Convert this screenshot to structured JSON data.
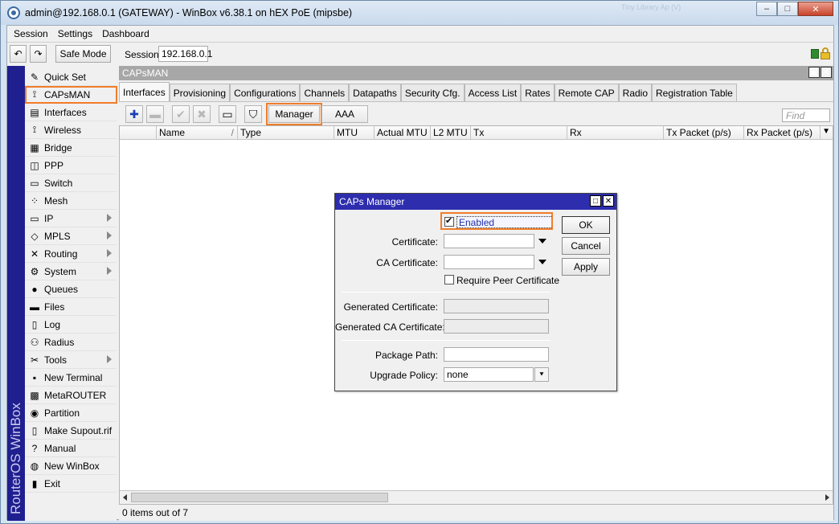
{
  "window": {
    "title": "admin@192.168.0.1 (GATEWAY) - WinBox v6.38.1 on hEX PoE (mipsbe)",
    "ghost_text": "Tiny Library Ap (V)",
    "minimize_glyph": "–",
    "maximize_glyph": "□",
    "close_glyph": "✕"
  },
  "menu": [
    "Session",
    "Settings",
    "Dashboard"
  ],
  "toolbar": {
    "undo_glyph": "↶",
    "redo_glyph": "↷",
    "safe_mode_label": "Safe Mode",
    "session_label": "Session:",
    "session_value": "192.168.0.1"
  },
  "brand": "RouterOS WinBox",
  "sidebar": {
    "items": [
      {
        "label": "Quick Set",
        "icon": "wand-icon",
        "glyph": "✎",
        "submenu": false
      },
      {
        "label": "CAPsMAN",
        "icon": "antenna-icon",
        "glyph": "⟟",
        "submenu": false
      },
      {
        "label": "Interfaces",
        "icon": "interfaces-icon",
        "glyph": "▤",
        "submenu": false
      },
      {
        "label": "Wireless",
        "icon": "wireless-icon",
        "glyph": "⟟",
        "submenu": false
      },
      {
        "label": "Bridge",
        "icon": "bridge-icon",
        "glyph": "▦",
        "submenu": false
      },
      {
        "label": "PPP",
        "icon": "ppp-icon",
        "glyph": "◫",
        "submenu": false
      },
      {
        "label": "Switch",
        "icon": "switch-icon",
        "glyph": "▭",
        "submenu": false
      },
      {
        "label": "Mesh",
        "icon": "mesh-icon",
        "glyph": "⁘",
        "submenu": false
      },
      {
        "label": "IP",
        "icon": "ip-icon",
        "glyph": "▭",
        "submenu": true
      },
      {
        "label": "MPLS",
        "icon": "mpls-icon",
        "glyph": "◇",
        "submenu": true
      },
      {
        "label": "Routing",
        "icon": "routing-icon",
        "glyph": "✕",
        "submenu": true
      },
      {
        "label": "System",
        "icon": "gear-icon",
        "glyph": "⚙",
        "submenu": true
      },
      {
        "label": "Queues",
        "icon": "queues-icon",
        "glyph": "●",
        "submenu": false
      },
      {
        "label": "Files",
        "icon": "folder-icon",
        "glyph": "▬",
        "submenu": false
      },
      {
        "label": "Log",
        "icon": "log-icon",
        "glyph": "▯",
        "submenu": false
      },
      {
        "label": "Radius",
        "icon": "radius-icon",
        "glyph": "⚇",
        "submenu": false
      },
      {
        "label": "Tools",
        "icon": "tools-icon",
        "glyph": "✂",
        "submenu": true
      },
      {
        "label": "New Terminal",
        "icon": "terminal-icon",
        "glyph": "▪",
        "submenu": false
      },
      {
        "label": "MetaROUTER",
        "icon": "metarouter-icon",
        "glyph": "▩",
        "submenu": false
      },
      {
        "label": "Partition",
        "icon": "partition-icon",
        "glyph": "◉",
        "submenu": false
      },
      {
        "label": "Make Supout.rif",
        "icon": "document-icon",
        "glyph": "▯",
        "submenu": false
      },
      {
        "label": "Manual",
        "icon": "help-icon",
        "glyph": "?",
        "submenu": false
      },
      {
        "label": "New WinBox",
        "icon": "globe-icon",
        "glyph": "◍",
        "submenu": false
      },
      {
        "label": "Exit",
        "icon": "exit-icon",
        "glyph": "▮",
        "submenu": false
      }
    ]
  },
  "panel": {
    "title": "CAPsMAN",
    "restore_glyph": "▣",
    "close_glyph": "✕",
    "tabs": [
      "Interfaces",
      "Provisioning",
      "Configurations",
      "Channels",
      "Datapaths",
      "Security Cfg.",
      "Access List",
      "Rates",
      "Remote CAP",
      "Radio",
      "Registration Table"
    ],
    "toolbar": {
      "add_glyph": "✚",
      "remove_glyph": "▬",
      "enable_glyph": "✔",
      "disable_glyph": "✖",
      "comment_glyph": "▭",
      "filter_glyph": "⛉",
      "manager_label": "Manager",
      "aaa_label": "AAA",
      "find_placeholder": "Find"
    },
    "columns": [
      "",
      "Name",
      "Type",
      "MTU",
      "Actual MTU",
      "L2 MTU",
      "Tx",
      "Rx",
      "Tx Packet (p/s)",
      "Rx Packet (p/s)"
    ],
    "sort_glyph": "/",
    "menu_glyph": "▼",
    "status": "0 items out of 7"
  },
  "dialog": {
    "title": "CAPs Manager",
    "restore_glyph": "□",
    "close_glyph": "✕",
    "enabled_label": "Enabled",
    "enabled_checked": true,
    "certificate_label": "Certificate:",
    "certificate_value": "",
    "ca_certificate_label": "CA Certificate:",
    "ca_certificate_value": "",
    "require_peer_label": "Require Peer Certificate",
    "require_peer_checked": false,
    "generated_cert_label": "Generated Certificate:",
    "generated_cert_value": "",
    "generated_ca_label": "Generated CA Certificate:",
    "generated_ca_value": "",
    "package_path_label": "Package Path:",
    "package_path_value": "",
    "upgrade_policy_label": "Upgrade Policy:",
    "upgrade_policy_value": "none",
    "upgrade_drop_glyph": "⯆",
    "ok_label": "OK",
    "cancel_label": "Cancel",
    "apply_label": "Apply"
  },
  "colors": {
    "accent_highlight": "#f07d2a",
    "dialog_title": "#2d2dae",
    "brand_strip": "#1f1f8f"
  }
}
